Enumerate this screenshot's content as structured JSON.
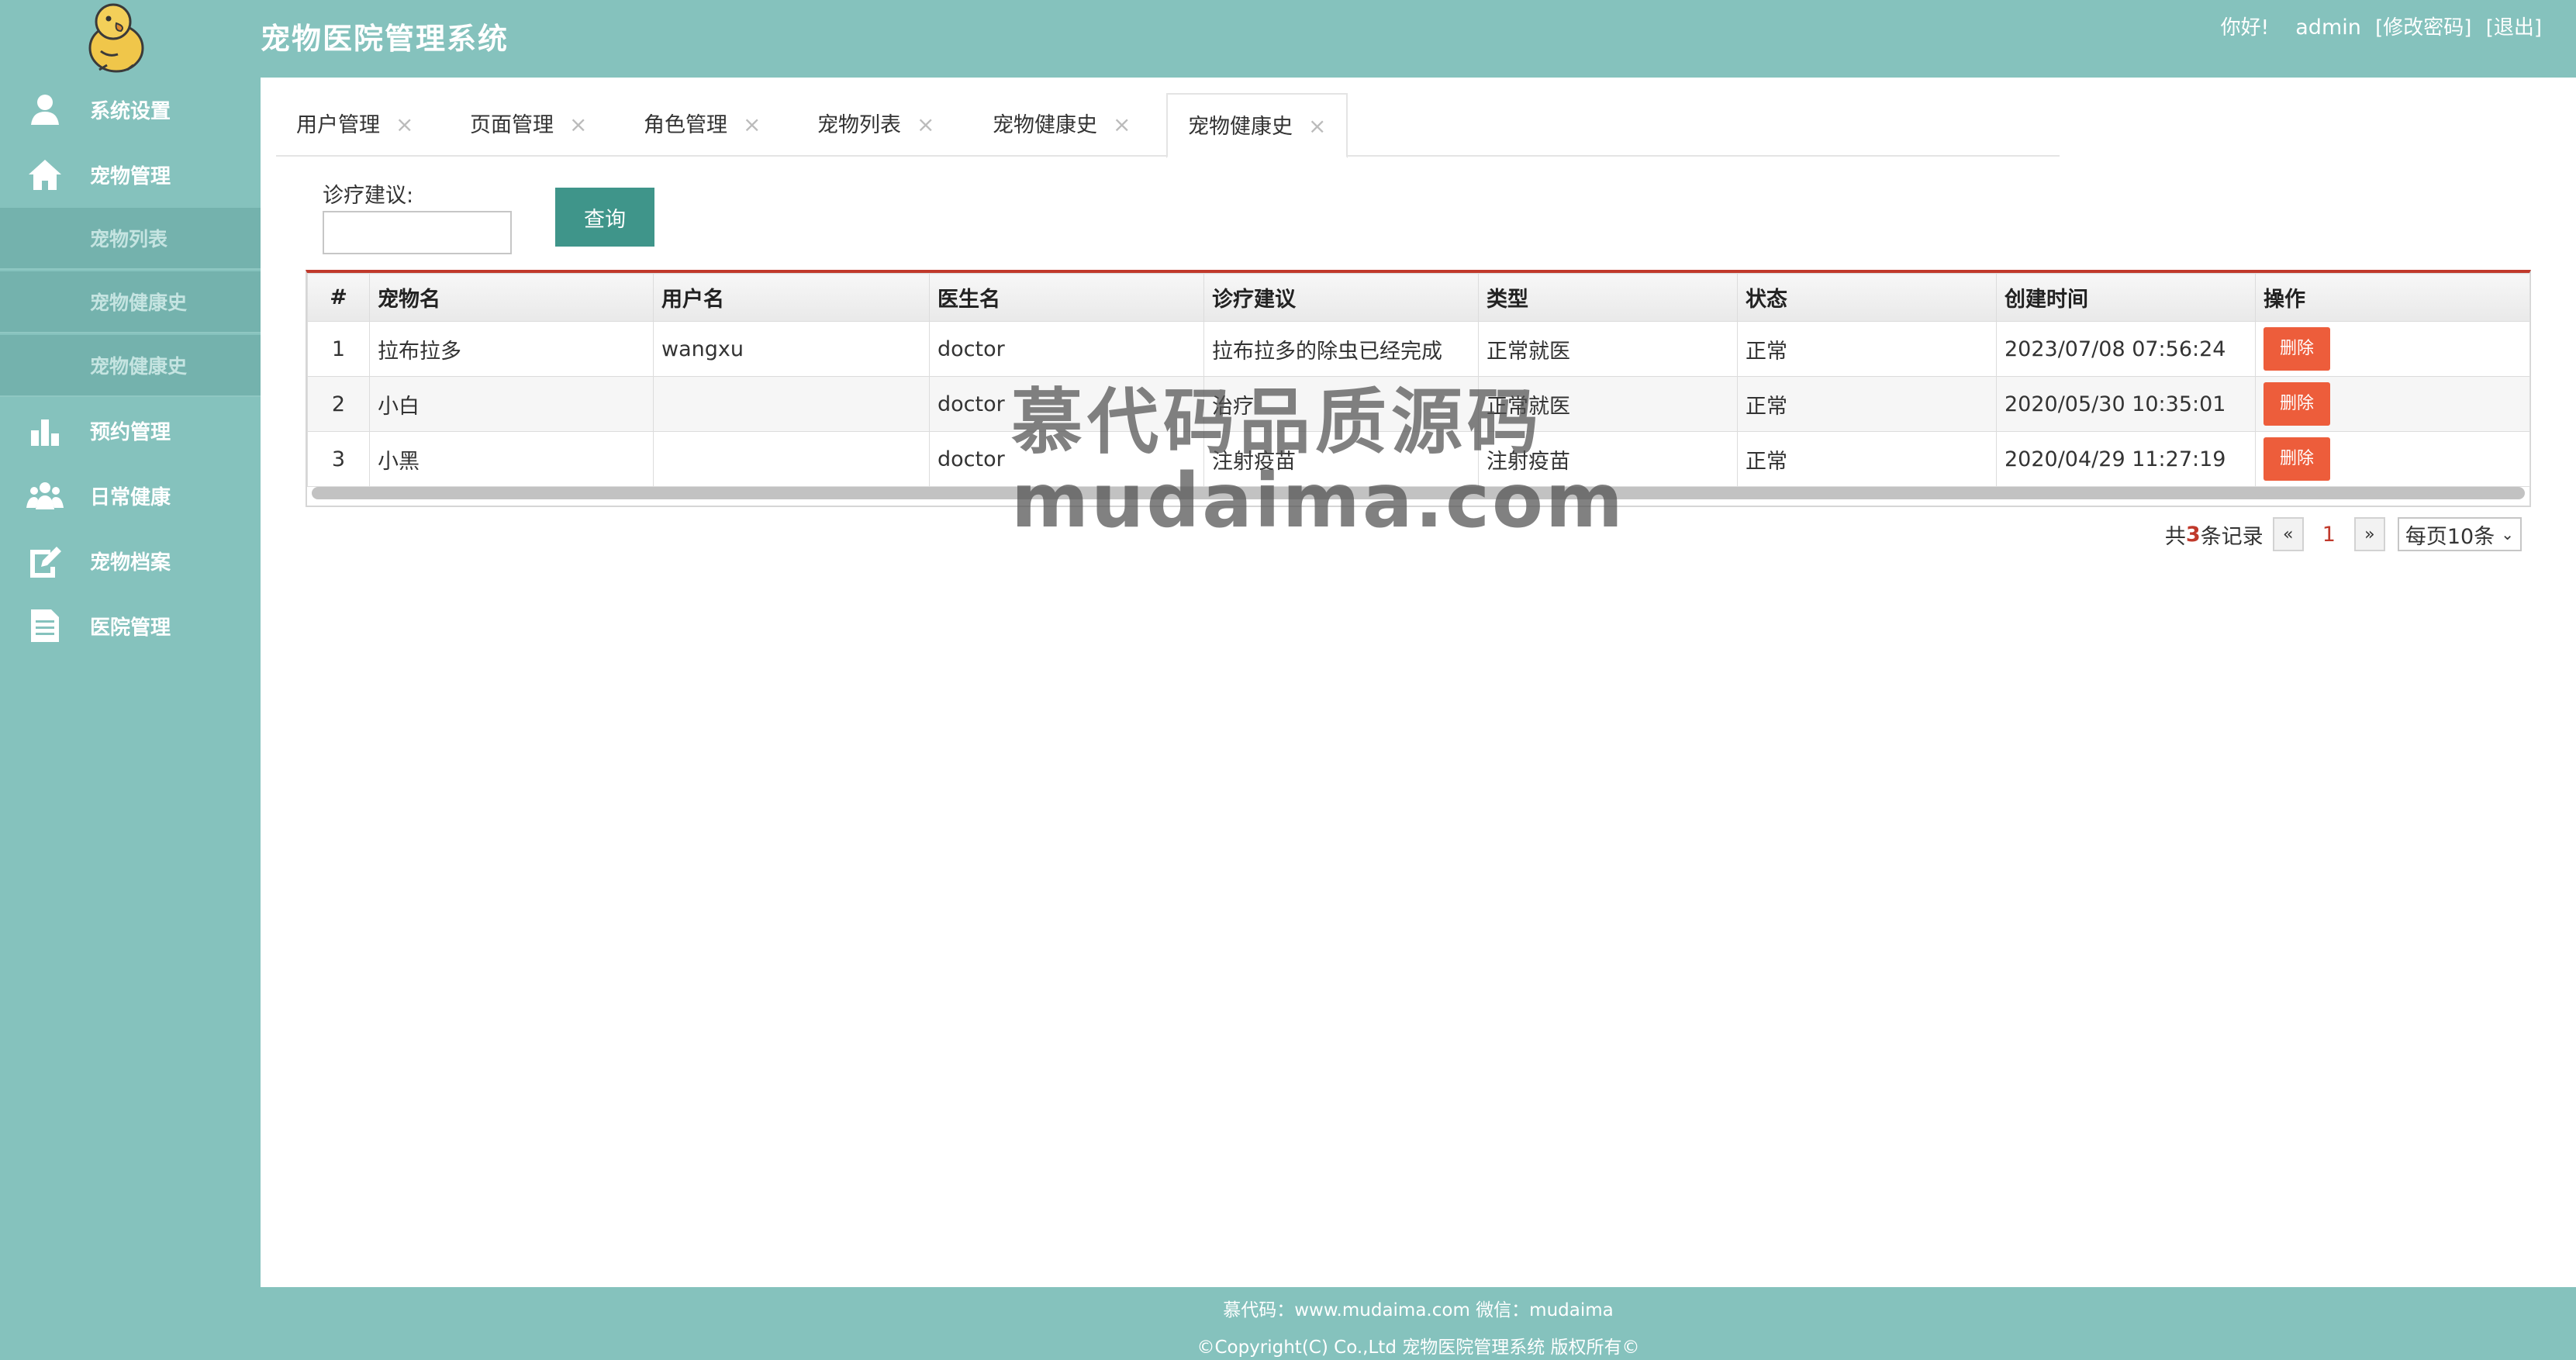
{
  "header": {
    "title": "宠物医院管理系统",
    "greeting": "你好!",
    "username": "admin",
    "change_password": "[修改密码]",
    "logout": "[退出]"
  },
  "sidebar": {
    "items": [
      {
        "label": "系统设置",
        "icon": "user-icon"
      },
      {
        "label": "宠物管理",
        "icon": "home-icon"
      },
      {
        "label": "预约管理",
        "icon": "bar-chart-icon"
      },
      {
        "label": "日常健康",
        "icon": "group-icon"
      },
      {
        "label": "宠物档案",
        "icon": "edit-icon"
      },
      {
        "label": "医院管理",
        "icon": "document-icon"
      }
    ],
    "sub_items": [
      "宠物列表",
      "宠物健康史",
      "宠物健康史"
    ]
  },
  "tabs": [
    {
      "label": "用户管理"
    },
    {
      "label": "页面管理"
    },
    {
      "label": "角色管理"
    },
    {
      "label": "宠物列表"
    },
    {
      "label": "宠物健康史"
    },
    {
      "label": "宠物健康史",
      "active": true
    }
  ],
  "search": {
    "label": "诊疗建议:",
    "value": "",
    "button": "查询"
  },
  "table": {
    "columns": [
      "#",
      "宠物名",
      "用户名",
      "医生名",
      "诊疗建议",
      "类型",
      "状态",
      "创建时间",
      "操作"
    ],
    "rows": [
      {
        "no": "1",
        "pet": "拉布拉多",
        "user": "wangxu",
        "doctor": "doctor",
        "advice": "拉布拉多的除虫已经完成",
        "type": "正常就医",
        "status": "正常",
        "created": "2023/07/08 07:56:24",
        "action": "删除"
      },
      {
        "no": "2",
        "pet": "小白",
        "user": "",
        "doctor": "doctor",
        "advice": "治疗",
        "type": "正常就医",
        "status": "正常",
        "created": "2020/05/30 10:35:01",
        "action": "删除"
      },
      {
        "no": "3",
        "pet": "小黑",
        "user": "",
        "doctor": "doctor",
        "advice": "注射疫苗",
        "type": "注射疫苗",
        "status": "正常",
        "created": "2020/04/29 11:27:19",
        "action": "删除"
      }
    ]
  },
  "pager": {
    "prefix": "共",
    "total": "3",
    "suffix": "条记录",
    "prev": "«",
    "current": "1",
    "next": "»",
    "page_size": "每页10条"
  },
  "watermark": {
    "line1": "慕代码品质源码",
    "line2": "mudaima.com"
  },
  "footer": {
    "line1": "慕代码：www.mudaima.com 微信：mudaima",
    "line2": "©Copyright(C) Co.,Ltd 宠物医院管理系统 版权所有©"
  },
  "colors": {
    "sidebar": "#85c2bd",
    "primary_button": "#3f958a",
    "danger_button": "#ed5d3b",
    "accent_red": "#c0392b"
  }
}
